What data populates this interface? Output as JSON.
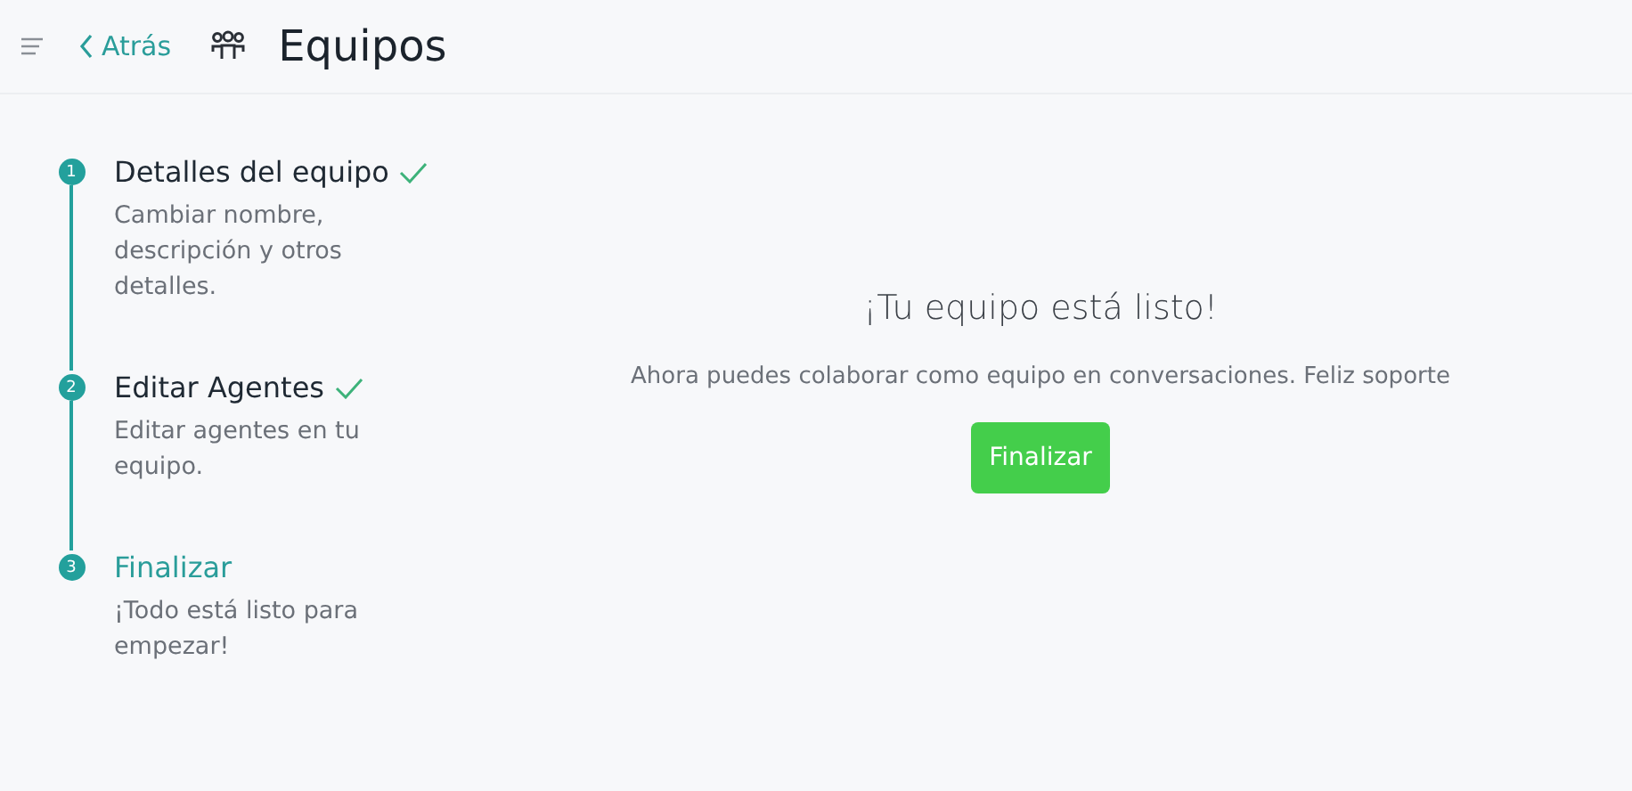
{
  "header": {
    "back_link": "Atrás",
    "title": "Equipos"
  },
  "steps": [
    {
      "number": "1",
      "title": "Detalles del equipo",
      "description": "Cambiar nombre, descripción y otros detalles.",
      "completed": true,
      "selected": false
    },
    {
      "number": "2",
      "title": "Editar Agentes",
      "description": "Editar agentes en tu equipo.",
      "completed": true,
      "selected": false
    },
    {
      "number": "3",
      "title": "Finalizar",
      "description": "¡Todo está listo para empezar!",
      "completed": false,
      "selected": true
    }
  ],
  "main": {
    "heading": "¡Tu equipo está listo!",
    "message": "Ahora puedes colaborar como equipo en conversaciones. Feliz soporte",
    "button": "Finalizar"
  }
}
